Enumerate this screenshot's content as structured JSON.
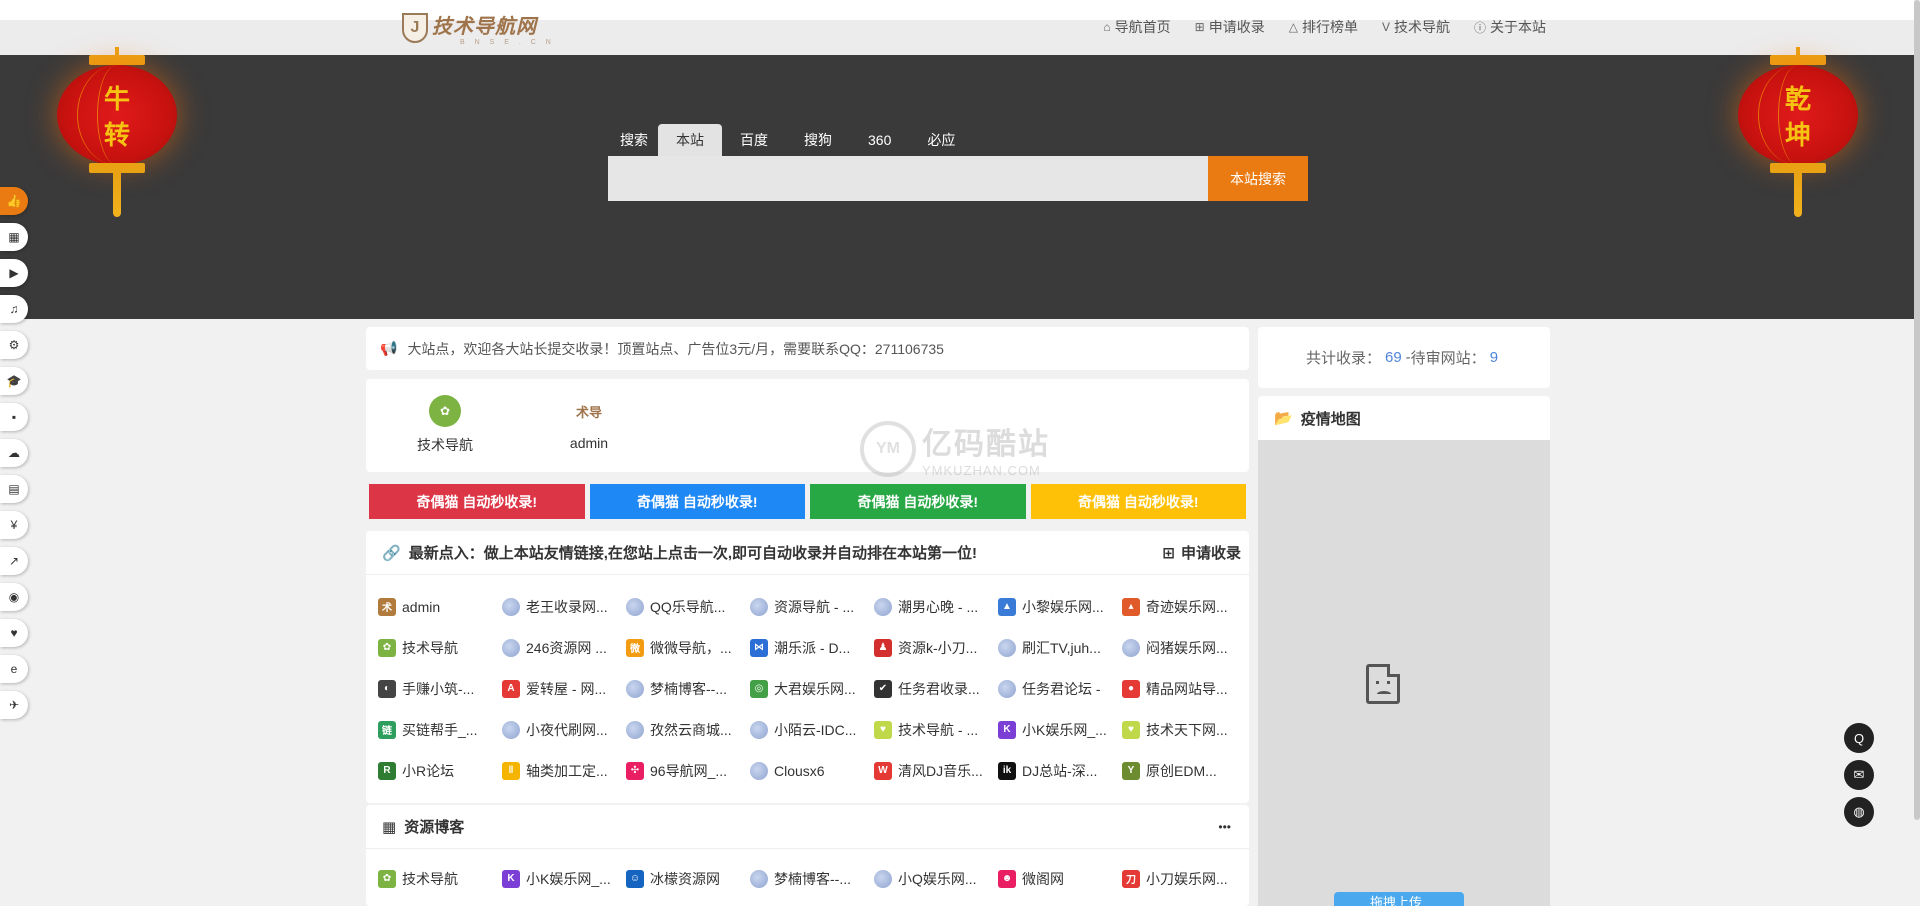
{
  "nav": {
    "logo_text": "技术导航网",
    "logo_sub": "B N S E . C N",
    "items": [
      {
        "label": "导航首页",
        "icon": "home-icon",
        "glyph": "⌂"
      },
      {
        "label": "申请收录",
        "icon": "plus-square-icon",
        "glyph": "⊞"
      },
      {
        "label": "排行榜单",
        "icon": "ranking-icon",
        "glyph": "△"
      },
      {
        "label": "技术导航",
        "icon": "vimeo-icon",
        "glyph": "V"
      },
      {
        "label": "关于本站",
        "icon": "info-icon",
        "glyph": "ⓘ"
      }
    ]
  },
  "lanterns": {
    "left": [
      "牛",
      "转"
    ],
    "right": [
      "乾",
      "坤"
    ]
  },
  "search": {
    "tabs": [
      "搜索",
      "本站",
      "百度",
      "搜狗",
      "360",
      "必应"
    ],
    "active_tab": "本站",
    "placeholder": "",
    "button": "本站搜索"
  },
  "notice": "大站点，欢迎各大站长提交收录！顶置站点、广告位3元/月，需要联系QQ：271106735",
  "stats": {
    "label_total": "共计收录：",
    "total": "69",
    "sep": " - ",
    "label_pending": "待审网站：",
    "pending": "9"
  },
  "recommend": [
    {
      "label": "技术导航",
      "icon_bg": "#7cb342",
      "glyph": "✿"
    },
    {
      "label": "admin",
      "icon_bg": "#ffffff",
      "glyph": "术导"
    }
  ],
  "watermark": {
    "main": "亿码酷站",
    "sub": "YMKUZHAN.COM"
  },
  "banners": [
    {
      "label": "奇偶猫 自动秒收录!",
      "color": "#dc3545"
    },
    {
      "label": "奇偶猫 自动秒收录!",
      "color": "#1e88f5"
    },
    {
      "label": "奇偶猫 自动秒收录!",
      "color": "#28a745"
    },
    {
      "label": "奇偶猫 自动秒收录!",
      "color": "#ffc107"
    }
  ],
  "links": {
    "title": "最新点入：做上本站友情链接,在您站上点击一次,即可自动收录并自动排在本站第一位!",
    "apply": "申请收录",
    "items": [
      {
        "label": "admin",
        "fav": "#b07b3c",
        "g": "术"
      },
      {
        "label": "老王收录网...",
        "fav": "globe",
        "g": ""
      },
      {
        "label": "QQ乐导航...",
        "fav": "globe",
        "g": ""
      },
      {
        "label": "资源导航 - ...",
        "fav": "globe",
        "g": ""
      },
      {
        "label": "潮男心晚 - ...",
        "fav": "globe",
        "g": ""
      },
      {
        "label": "小黎娱乐网...",
        "fav": "#3b7bd8",
        "g": "▲"
      },
      {
        "label": "奇迹娱乐网...",
        "fav": "#e05a2a",
        "g": "▴"
      },
      {
        "label": "技术导航",
        "fav": "#7cb342",
        "g": "✿"
      },
      {
        "label": "246资源网 ...",
        "fav": "globe",
        "g": ""
      },
      {
        "label": "微微导航，...",
        "fav": "#f39c12",
        "g": "微"
      },
      {
        "label": "潮乐派 - D...",
        "fav": "#2b6fd6",
        "g": "⋈"
      },
      {
        "label": "资源k-小刀...",
        "fav": "#d32f2f",
        "g": "♟"
      },
      {
        "label": "刷汇TV,juh...",
        "fav": "globe",
        "g": ""
      },
      {
        "label": "闷猪娱乐网...",
        "fav": "globe",
        "g": ""
      },
      {
        "label": "手赚小筑-...",
        "fav": "#444444",
        "g": "◐"
      },
      {
        "label": "爱转屋 - 网...",
        "fav": "#e53935",
        "g": "A"
      },
      {
        "label": "梦楠博客--...",
        "fav": "globe",
        "g": ""
      },
      {
        "label": "大君娱乐网...",
        "fav": "#43a047",
        "g": "◎"
      },
      {
        "label": "任务君收录...",
        "fav": "#333333",
        "g": "✔"
      },
      {
        "label": "任务君论坛 -",
        "fav": "globe",
        "g": ""
      },
      {
        "label": "精品网站导...",
        "fav": "#e53935",
        "g": "●"
      },
      {
        "label": "买链帮手_...",
        "fav": "#2e9e5e",
        "g": "链"
      },
      {
        "label": "小夜代刷网...",
        "fav": "globe",
        "g": ""
      },
      {
        "label": "孜然云商城...",
        "fav": "globe",
        "g": ""
      },
      {
        "label": "小陌云-IDC...",
        "fav": "globe",
        "g": ""
      },
      {
        "label": "技术导航 - ...",
        "fav": "#c0d94a",
        "g": "♥"
      },
      {
        "label": "小K娱乐网_...",
        "fav": "#7b3fd6",
        "g": "K"
      },
      {
        "label": "技术天下网...",
        "fav": "#c0d94a",
        "g": "♥"
      },
      {
        "label": "小R论坛",
        "fav": "#2e7d32",
        "g": "R"
      },
      {
        "label": "轴类加工定...",
        "fav": "#f4b400",
        "g": "‖"
      },
      {
        "label": "96导航网_...",
        "fav": "#e91e63",
        "g": "✣"
      },
      {
        "label": "Clousx6",
        "fav": "globe",
        "g": ""
      },
      {
        "label": "清风DJ音乐...",
        "fav": "#e53935",
        "g": "W"
      },
      {
        "label": "DJ总站-深...",
        "fav": "#111111",
        "g": "ik"
      },
      {
        "label": "原创EDM...",
        "fav": "#6d8b2f",
        "g": "Y"
      }
    ]
  },
  "blog": {
    "title": "资源博客",
    "more": "•••",
    "items": [
      {
        "label": "技术导航",
        "fav": "#7cb342",
        "g": "✿"
      },
      {
        "label": "小K娱乐网_...",
        "fav": "#7b3fd6",
        "g": "K"
      },
      {
        "label": "冰檬资源网",
        "fav": "#1565c0",
        "g": "☺"
      },
      {
        "label": "梦楠博客--...",
        "fav": "globe",
        "g": ""
      },
      {
        "label": "小Q娱乐网...",
        "fav": "globe",
        "g": ""
      },
      {
        "label": "微阁网",
        "fav": "#e91e63",
        "g": "☻"
      },
      {
        "label": "小刀娱乐网...",
        "fav": "#e53935",
        "g": "刀"
      }
    ]
  },
  "map": {
    "title": "疫情地图",
    "upload_label": "拖拽上传"
  },
  "left_float_icons": [
    "thumbs-up-icon",
    "store-icon",
    "youtube-icon",
    "music-icon",
    "bicycle-icon",
    "graduation-cap-icon",
    "grid-icon",
    "cloud-icon",
    "file-icon",
    "yen-icon",
    "chart-line-icon",
    "compass-icon",
    "heartbeat-icon",
    "edge-icon",
    "paper-plane-icon"
  ],
  "left_float_glyphs": [
    "👍",
    "▦",
    "▶",
    "♫",
    "⚙",
    "🎓",
    "▪",
    "☁",
    "▤",
    "¥",
    "↗",
    "◉",
    "♥",
    "e",
    "✈"
  ],
  "right_float": [
    {
      "icon": "qq-icon",
      "glyph": "Q"
    },
    {
      "icon": "mail-icon",
      "glyph": "✉"
    },
    {
      "icon": "wechat-icon",
      "glyph": "◍"
    }
  ]
}
